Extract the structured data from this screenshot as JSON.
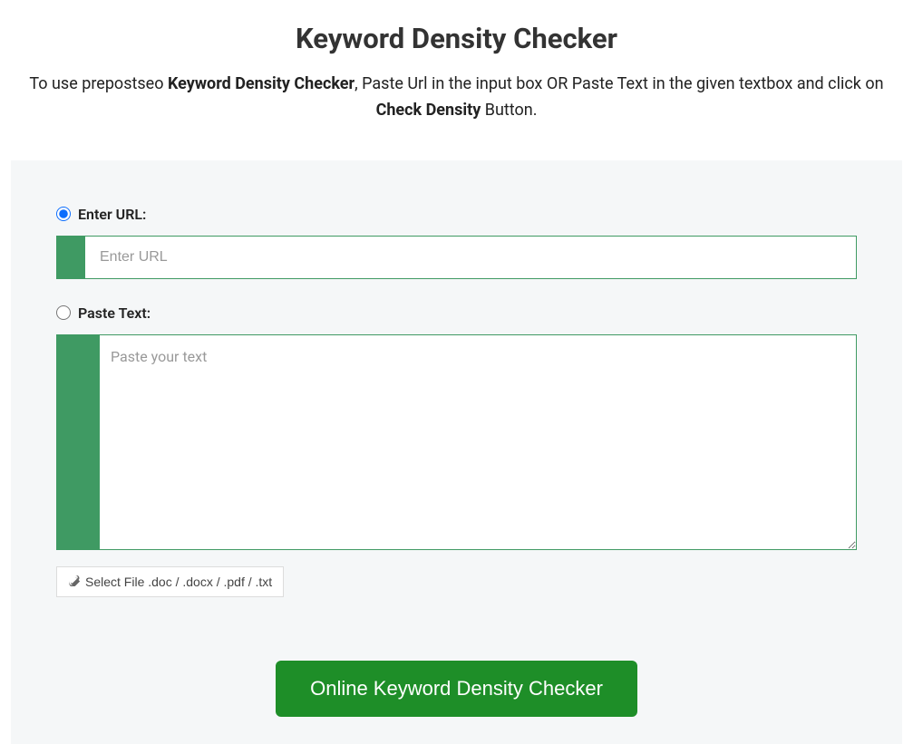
{
  "header": {
    "title": "Keyword Density Checker",
    "description_prefix": "To use prepostseo ",
    "description_bold1": "Keyword Density Checker",
    "description_mid": ", Paste Url in the input box OR Paste Text in the given textbox and click on ",
    "description_bold2": "Check Density",
    "description_suffix": " Button."
  },
  "form": {
    "url_radio_label": "Enter URL:",
    "url_placeholder": "Enter URL",
    "text_radio_label": "Paste Text:",
    "text_placeholder": "Paste your text",
    "file_button_label": "Select File .doc / .docx / .pdf / .txt",
    "submit_label": "Online Keyword Density Checker"
  }
}
